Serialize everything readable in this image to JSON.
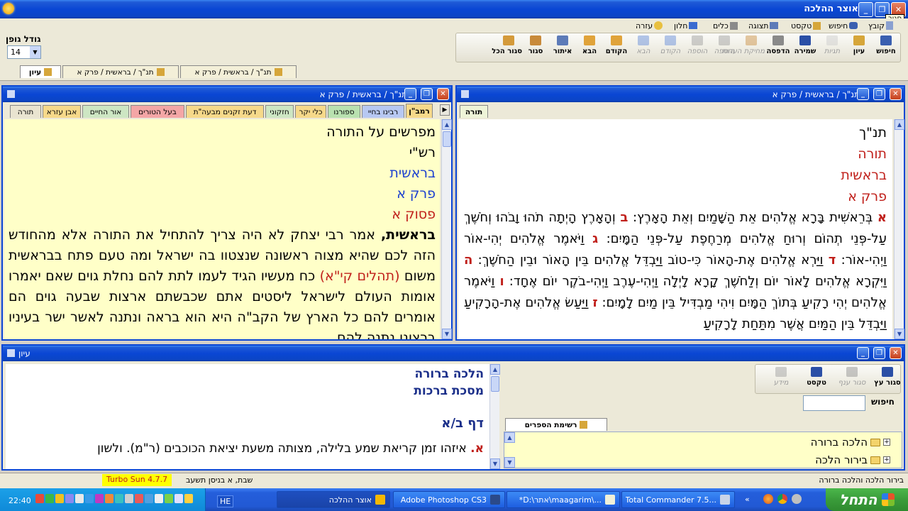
{
  "app": {
    "title": "אוצר ההלכה",
    "close_tooltip": "סגור"
  },
  "menu": [
    {
      "label": "קובץ",
      "icon": "file-icon"
    },
    {
      "label": "חיפוש",
      "icon": "binoculars-icon"
    },
    {
      "label": "טקסט",
      "icon": "book-icon"
    },
    {
      "label": "תצוגה",
      "icon": "display-icon"
    },
    {
      "label": "כלים",
      "icon": "tools-icon"
    },
    {
      "label": "חלון",
      "icon": "window-icon"
    },
    {
      "label": "עזרה",
      "icon": "help-icon"
    }
  ],
  "toolbar": [
    {
      "label": "חיפוש",
      "icon": "binoculars-icon",
      "enabled": true,
      "color": "#3a5fb0"
    },
    {
      "label": "עיון",
      "icon": "book-icon",
      "enabled": true,
      "color": "#d6a63a"
    },
    {
      "label": "תגיות",
      "icon": "bulb-icon",
      "enabled": false,
      "color": "#c9c9c9"
    },
    {
      "label": "שמירה",
      "icon": "save-icon",
      "enabled": true,
      "color": "#2b4fa6"
    },
    {
      "label": "הדפסה",
      "icon": "print-icon",
      "enabled": true,
      "color": "#8a8a8a"
    },
    {
      "label": "מחיקת הערות",
      "icon": "eraser-icon",
      "enabled": false,
      "color": "#c88a3a"
    },
    {
      "label": "הוספה",
      "icon": "add-icon",
      "enabled": false,
      "color": "#9a9a9a"
    },
    {
      "label": "הוספה",
      "icon": "add-more-icon",
      "enabled": false,
      "color": "#9a9a9a"
    },
    {
      "label": "הקודם",
      "icon": "back-icon",
      "enabled": false,
      "color": "#5b85d6"
    },
    {
      "label": "הבא",
      "icon": "forward-icon",
      "enabled": false,
      "color": "#5b85d6"
    },
    {
      "label": "הקודם",
      "icon": "prev-book-icon",
      "enabled": true,
      "color": "#e0a33a"
    },
    {
      "label": "הבא",
      "icon": "next-book-icon",
      "enabled": true,
      "color": "#e0a33a"
    },
    {
      "label": "איתור",
      "icon": "locate-icon",
      "enabled": true,
      "color": "#5d7bb8"
    },
    {
      "label": "סגור",
      "icon": "close-book-icon",
      "enabled": true,
      "color": "#c88a3a"
    },
    {
      "label": "סגור הכל",
      "icon": "close-all-icon",
      "enabled": true,
      "color": "#d49a3a"
    }
  ],
  "font": {
    "label": "גודל גופן",
    "value": "14"
  },
  "doc_tabs": [
    {
      "label": "עיון"
    },
    {
      "label": "תנ\"ך / בראשית / פרק א"
    },
    {
      "label": "תנ\"ך / בראשית / פרק א"
    }
  ],
  "left_window": {
    "title": "תנ\"ך / בראשית / פרק א",
    "tabs": [
      {
        "label": "רמב\"ן",
        "color": "#f6d98a"
      },
      {
        "label": "רבינו בחיי",
        "color": "#b7c8f2"
      },
      {
        "label": "ספורנו",
        "color": "#b9e1b0"
      },
      {
        "label": "כלי יקר",
        "color": "#f6d98a"
      },
      {
        "label": "חזקוני",
        "color": "#cde6c3"
      },
      {
        "label": "דעת זקנים מבעה\"ת",
        "color": "#f6d98a"
      },
      {
        "label": "בעל הטורים",
        "color": "#f4a6a6"
      },
      {
        "label": "אור החיים",
        "color": "#cde6c3"
      },
      {
        "label": "אבן עזרא",
        "color": "#f6d98a"
      },
      {
        "label": "תורה",
        "color": "#e9e4d0"
      }
    ],
    "headers": [
      {
        "text": "מפרשים על התורה",
        "color": "#000000"
      },
      {
        "text": "רש\"י",
        "color": "#000000"
      },
      {
        "text": "בראשית",
        "color": "#1a3fd0"
      },
      {
        "text": "פרק א",
        "color": "#1a3fd0"
      },
      {
        "text": "פסוק א",
        "color": "#c0201b"
      }
    ],
    "lead": "בראשית,",
    "body_1": "אמר רבי יצחק לא היה צריך להתחיל את התורה אלא מהחודש הזה לכם שהיא מצוה ראשונה שנצטוו בה ישראל ומה טעם פתח בבראשית משום",
    "ref": "(תהלים קי\"א)",
    "body_2": "כח מעשיו הגיד לעמו לתת להם נחלת גוים שאם יאמרו אומות העולם לישראל ליסטים אתם שכבשתם ארצות שבעה גוים הם אומרים להם כל הארץ של הקב\"ה היא הוא בראה ונתנה לאשר ישר בעיניו ברצונו נתנה להם"
  },
  "right_window": {
    "title": "תנ\"ך / בראשית / פרק א",
    "tab": "תורה",
    "headers": [
      {
        "text": "תנ\"ך",
        "color": "#000000"
      },
      {
        "text": "תורה",
        "color": "#c0201b"
      },
      {
        "text": "בראשית",
        "color": "#c0201b"
      },
      {
        "text": "פרק א",
        "color": "#c0201b"
      }
    ],
    "verses": [
      {
        "mark": "א",
        "text": "בְּרֵאשִׁית בָּרָא אֱלֹהִים אֵת הַשָּׁמַיִם וְאֵת הָאָרֶץ:"
      },
      {
        "mark": "ב",
        "text": "וְהָאָרֶץ הָיְתָה תֹהוּ וָבֹהוּ וְחֹשֶׁךְ עַל-פְּנֵי תְהוֹם וְרוּחַ אֱלֹהִים מְרַחֶפֶת עַל-פְּנֵי הַמָּיִם:"
      },
      {
        "mark": "ג",
        "text": "וַיֹּאמֶר אֱלֹהִים יְהִי-אוֹר וַיְהִי-אוֹר:"
      },
      {
        "mark": "ד",
        "text": "וַיַּרְא אֱלֹהִים אֶת-הָאוֹר כִּי-טוֹב וַיַּבְדֵּל אֱלֹהִים בֵּין הָאוֹר וּבֵין הַחֹשֶׁךְ:"
      },
      {
        "mark": "ה",
        "text": "וַיִּקְרָא אֱלֹהִים לָאוֹר יוֹם וְלַחֹשֶׁךְ קָרָא לָיְלָה וַיְהִי-עֶרֶב וַיְהִי-בֹקֶר יוֹם אֶחָד:"
      },
      {
        "mark": "ו",
        "text": "וַיֹּאמֶר אֱלֹהִים יְהִי רָקִיעַ בְּתוֹךְ הַמָּיִם וִיהִי מַבְדִּיל בֵּין מַיִם לָמָיִם:"
      },
      {
        "mark": "ז",
        "text": "וַיַּעַשׂ אֱלֹהִים אֶת-הָרָקִיעַ וַיַּבְדֵּל בֵּין הַמַּיִם אֲשֶׁר מִתַּחַת לָרָקִיעַ"
      }
    ]
  },
  "bottom_window": {
    "title": "עיון",
    "toolbar": [
      {
        "label": "סגור עץ",
        "icon": "close-tree-icon",
        "enabled": true
      },
      {
        "label": "סגור ענף",
        "icon": "close-branch-icon",
        "enabled": false
      },
      {
        "label": "טקסט",
        "icon": "text-book-icon",
        "enabled": true
      },
      {
        "label": "מידע",
        "icon": "info-icon",
        "enabled": false
      }
    ],
    "search_label": "חיפוש",
    "search_value": "",
    "list_tab": "רשימת הספרים",
    "tree": [
      {
        "label": "הלכה ברורה"
      },
      {
        "label": "בירור הלכה"
      }
    ],
    "text_title_1": "הלכה ברורה",
    "text_title_2": "מסכת ברכות",
    "daf": "דף ב/א",
    "para_mark": "א.",
    "para_text": "איזהו זמן קריאת שמע בלילה, מצותה משעת יציאת הכוכבים (ר\"מ). ולשון"
  },
  "status": {
    "left": "בירור הלכה והלכה ברורה",
    "date": "שבת, א בניסן תשעב",
    "version": "Turbo Sun 4.7.7"
  },
  "taskbar": {
    "start": "התחל",
    "tasks": [
      {
        "label": "Total Commander 7.5...",
        "icon": "floppy-icon"
      },
      {
        "label": "*D:\\אתר\\maagarim\\...",
        "icon": "notepad-icon"
      },
      {
        "label": "Adobe Photoshop CS3",
        "icon": "ps-icon"
      },
      {
        "label": "אוצר ההלכה",
        "icon": "sun-icon"
      }
    ],
    "lang": "HE",
    "clock": "22:40"
  }
}
